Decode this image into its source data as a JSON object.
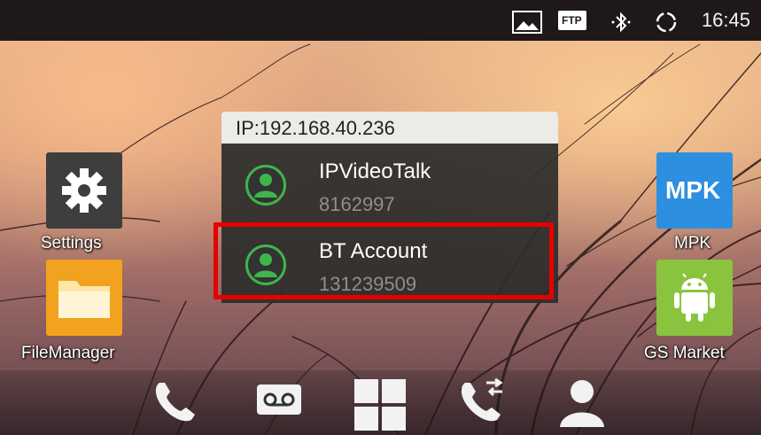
{
  "status_bar": {
    "icons": [
      "image-icon",
      "ftp-icon",
      "bluetooth-icon",
      "sync-icon"
    ],
    "ftp_label": "FTP",
    "time": "16:45"
  },
  "popup": {
    "title": "IP:192.168.40.236",
    "accounts": [
      {
        "name": "IPVideoTalk",
        "number": "8162997",
        "icon": "contact-icon"
      },
      {
        "name": "BT Account",
        "number": "131239509",
        "icon": "contact-icon",
        "highlighted": true
      }
    ]
  },
  "apps": {
    "settings": {
      "label": "Settings",
      "icon": "gear-icon"
    },
    "file_manager": {
      "label": "FileManager",
      "icon": "folder-icon"
    },
    "mpk": {
      "label": "MPK",
      "icon_text": "MPK"
    },
    "gs_market": {
      "label": "GS Market",
      "icon": "android-icon"
    }
  },
  "dock": {
    "items": [
      "phone-icon",
      "voicemail-icon",
      "apps-grid-icon",
      "call-transfer-icon",
      "contacts-icon"
    ]
  },
  "colors": {
    "accent_green": "#3fb54b",
    "highlight_red": "#e60000",
    "mpk_blue": "#2d8fe0",
    "filemanager_orange": "#f2a21f",
    "market_green": "#8ac43f"
  }
}
